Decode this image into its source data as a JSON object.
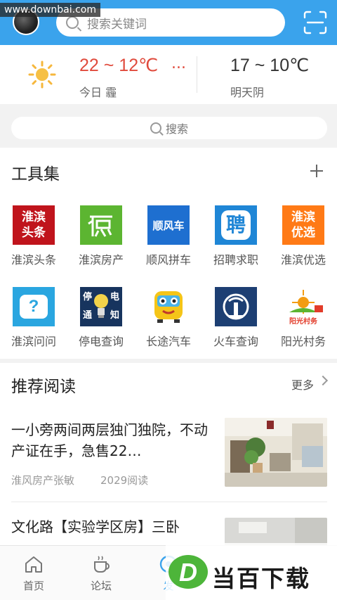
{
  "watermark": "www.downbai.com",
  "header": {
    "search_placeholder": "搜索关键词"
  },
  "weather": {
    "today_temp": "22 ~ 12℃",
    "today_more": "...",
    "today_label": "今日 霾",
    "tomorrow_temp": "17 ~ 10℃",
    "tomorrow_label": "明天阴"
  },
  "search2": {
    "label": "搜索"
  },
  "tools": {
    "title": "工具集",
    "items": [
      {
        "label": "淮滨头条",
        "icon_text": "淮滨\n头条",
        "color": "#c0141c"
      },
      {
        "label": "淮滨房产",
        "icon_text": "房",
        "color": "#5cb531"
      },
      {
        "label": "顺风拼车",
        "icon_text": "顺风车",
        "color": "#1e6fd0"
      },
      {
        "label": "招聘求职",
        "icon_text": "聘",
        "color": "#1f86d6"
      },
      {
        "label": "淮滨优选",
        "icon_text": "淮滨\n优选",
        "color": "#ff7a16"
      },
      {
        "label": "淮滨问问",
        "icon_text": "?",
        "color": "#2aa6e0"
      },
      {
        "label": "停电查询",
        "icon_text": "停 电\n通 知",
        "color": "#17345e"
      },
      {
        "label": "长途汽车",
        "icon_text": "",
        "color": "#f5c518"
      },
      {
        "label": "火车查询",
        "icon_text": "",
        "color": "#1d3f73"
      },
      {
        "label": "阳光村务",
        "icon_text": "阳光村务",
        "color": "#e23c2a"
      }
    ]
  },
  "recommend": {
    "title": "推荐阅读",
    "more": "更多",
    "articles": [
      {
        "title": "一小旁两间两层独门独院，不动产证在手，急售22…",
        "source": "淮风房产张敏",
        "views": "2029阅读"
      },
      {
        "title": "文化路【实验学区房】三卧",
        "source": "",
        "views": ""
      }
    ]
  },
  "bottom_nav": {
    "items": [
      {
        "label": "首页"
      },
      {
        "label": "论坛"
      },
      {
        "label": "发"
      }
    ]
  },
  "brand": {
    "text": "当百下载",
    "letter": "D"
  }
}
